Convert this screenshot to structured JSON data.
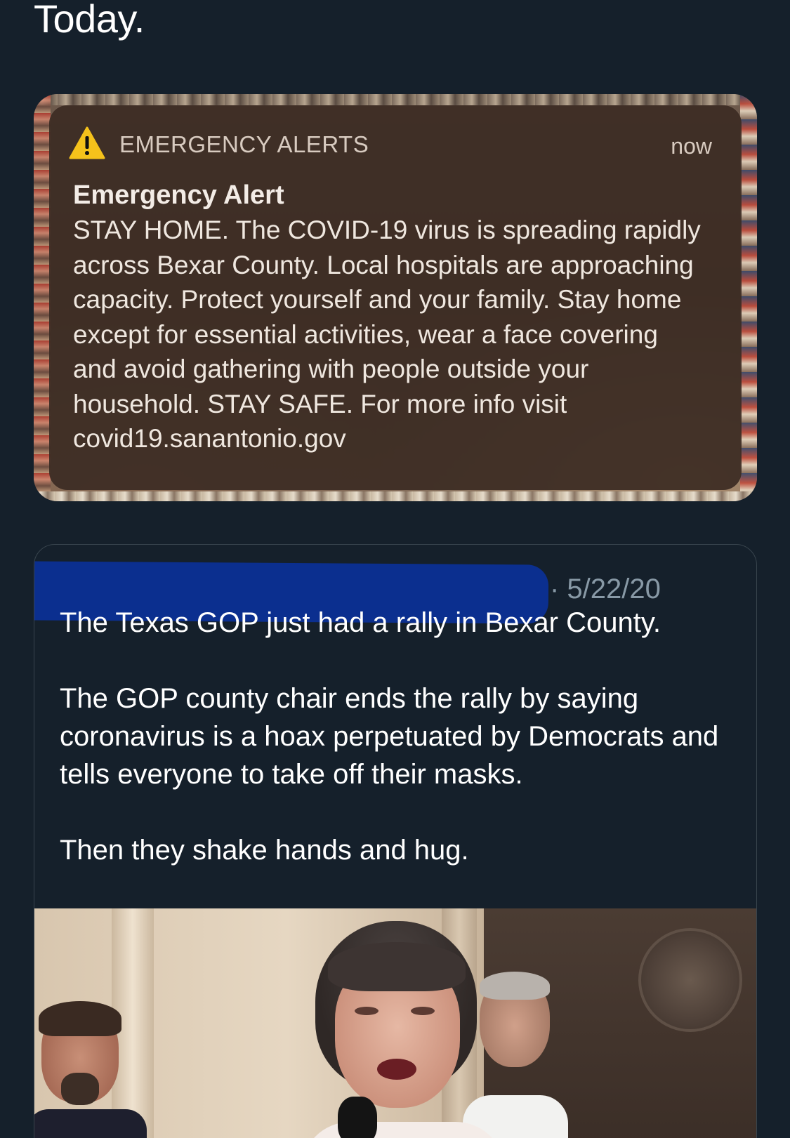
{
  "tweet": {
    "text_visible": "Today."
  },
  "alert": {
    "app_name": "EMERGENCY ALERTS",
    "time": "now",
    "title": "Emergency Alert",
    "body": "STAY HOME. The COVID-19 virus is spreading rapidly across Bexar County. Local hospitals are approaching capacity. Protect yourself and your family. Stay home except for essential activities, wear a face covering and avoid gathering with people outside your household. STAY SAFE. For more info visit covid19.sanantonio.gov",
    "icon": "warning-triangle-icon",
    "accent_color": "#f5c21b"
  },
  "quote_tweet": {
    "date": "· 5/22/20",
    "paragraphs": [
      "The Texas GOP just had a rally in Bexar County.",
      "The GOP county chair ends the rally by saying coronavirus is a hoax perpetuated by Democrats and tells everyone to take off their masks.",
      "Then they shake hands and hug."
    ],
    "redaction_color": "#0b2f8f"
  },
  "theme": {
    "background": "#15202b",
    "border": "#38444d",
    "secondary_text": "#8899a6"
  }
}
